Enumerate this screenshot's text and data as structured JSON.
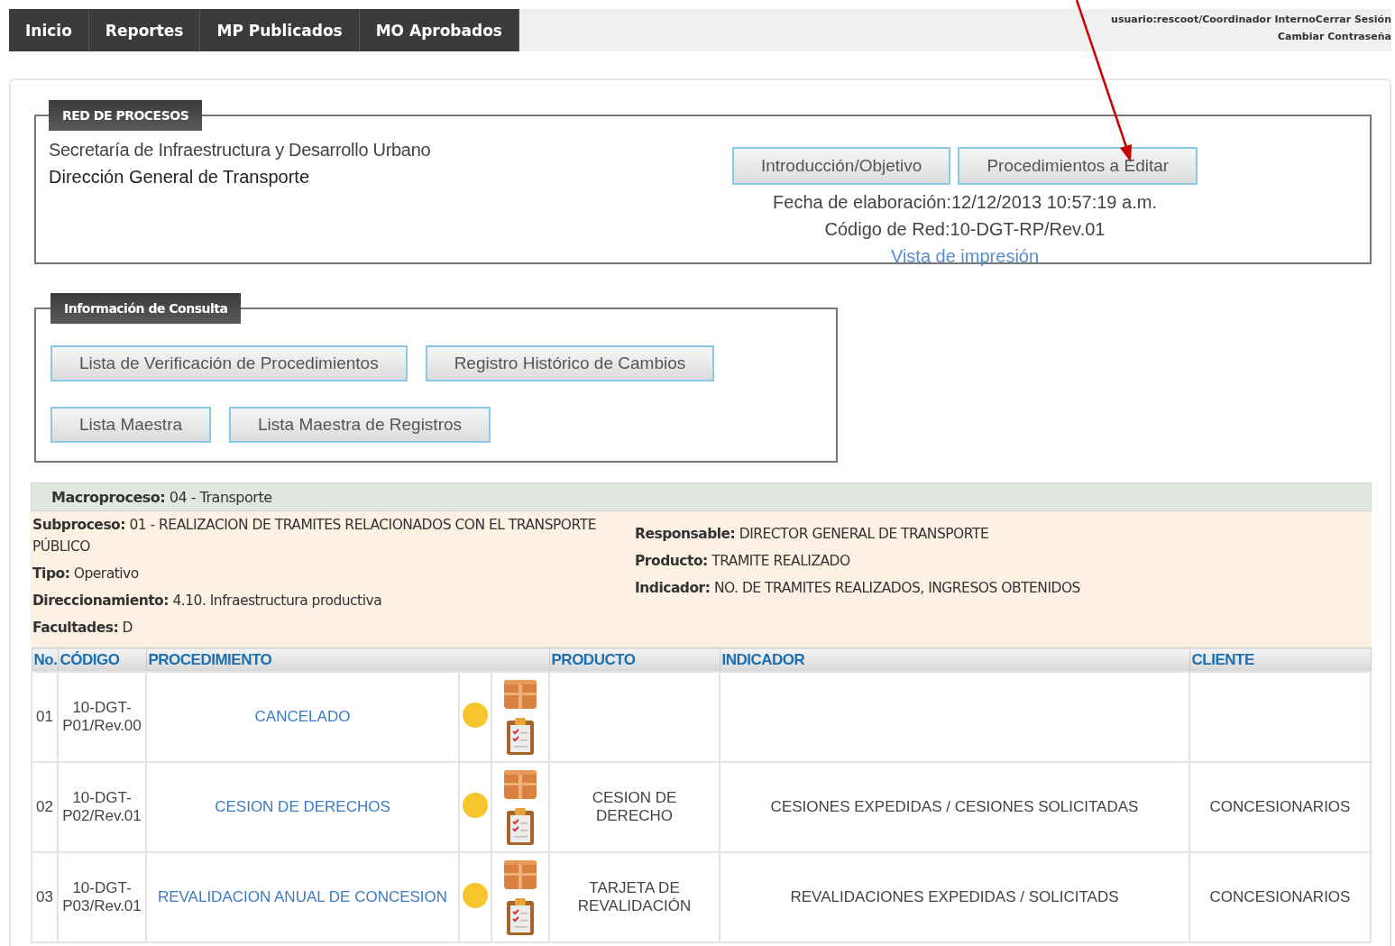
{
  "nav": {
    "tabs": [
      {
        "label": "Inicio"
      },
      {
        "label": "Reportes"
      },
      {
        "label": "MP Publicados"
      },
      {
        "label": "MO Aprobados"
      }
    ]
  },
  "user_bar": {
    "user": "usuario:rescoot/Coordinador Interno",
    "logout": "Cerrar Sesión",
    "change_password": "Cambiar Contraseña"
  },
  "process_network": {
    "legend": "RED DE PROCESOS",
    "secretariat": "Secretaría de Infraestructura y Desarrollo Urbano",
    "directorate": "Dirección General de Transporte",
    "buttons": [
      "Introducción/Objetivo",
      "Procedimientos a Editar"
    ],
    "date": "Fecha de elaboración:12/12/2013 10:57:19 a.m.",
    "code": "Código de Red:10-DGT-RP/Rev.01",
    "print_link": "Vista de impresión"
  },
  "consultation": {
    "legend": "Información de Consulta",
    "button_rows": [
      [
        "Lista de Verificación de Procedimientos",
        "Registro Histórico de Cambios"
      ],
      [
        "Lista Maestra",
        "Lista Maestra de Registros"
      ]
    ]
  },
  "macroprocess": {
    "label": "Macroproceso:",
    "value": "04 - Transporte"
  },
  "details": {
    "left": [
      {
        "label": "Subproceso:",
        "value": "01 - REALIZACION DE TRAMITES RELACIONADOS CON EL TRANSPORTE PÚBLICO"
      },
      {
        "label": "Tipo:",
        "value": "Operativo"
      },
      {
        "label": "Direccionamiento:",
        "value": "4.10. Infraestructura productiva"
      },
      {
        "label": "Facultades:",
        "value": "D"
      }
    ],
    "right": [
      {
        "label": "Responsable:",
        "value": "DIRECTOR GENERAL DE TRANSPORTE"
      },
      {
        "label": "Producto:",
        "value": "TRAMITE REALIZADO"
      },
      {
        "label": "Indicador:",
        "value": "NO. DE TRAMITES REALIZADOS, INGRESOS OBTENIDOS"
      }
    ]
  },
  "table": {
    "columns": [
      "No.",
      "CÓDIGO",
      "PROCEDIMIENTO",
      "PRODUCTO",
      "INDICADOR",
      "CLIENTE"
    ],
    "rows": [
      {
        "no": "01",
        "code": "10-DGT-P01/Rev.00",
        "procedure": "CANCELADO",
        "color": "#f7c62f"
      },
      {
        "no": "02",
        "code": "10-DGT-P02/Rev.01",
        "procedure": "CESION DE DERECHOS",
        "color": "#f7c62f",
        "product": "CESION DE DERECHO",
        "indicator": "CESIONES EXPEDIDAS / CESIONES SOLICITADAS",
        "client": "CONCESIONARIOS"
      },
      {
        "no": "03",
        "code": "10-DGT-P03/Rev.01",
        "procedure": "REVALIDACION ANUAL DE CONCESION",
        "color": "#f7c62f",
        "product": "TARJETA DE REVALIDACIÓN",
        "indicator": "REVALIDACIONES EXPEDIDAS / SOLICITADS",
        "client": "CONCESIONARIOS"
      }
    ]
  }
}
